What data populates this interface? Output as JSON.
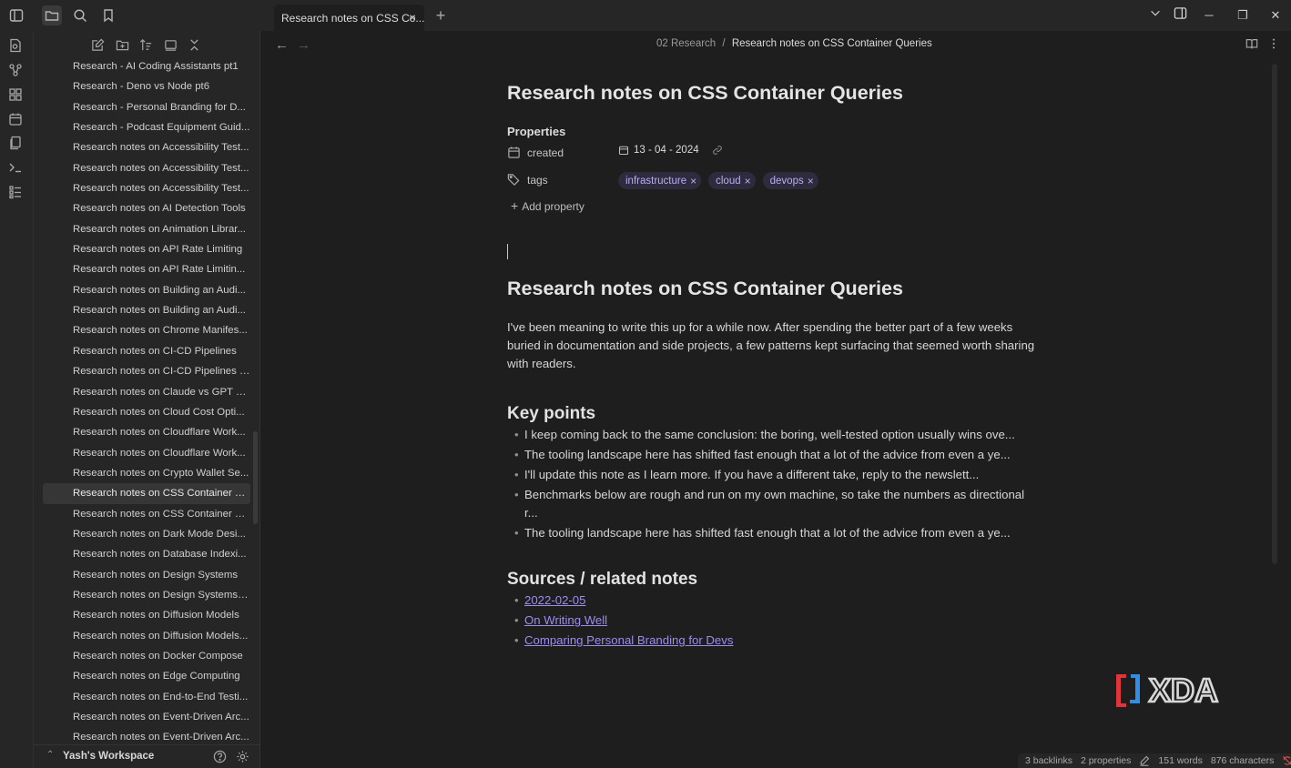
{
  "tab": {
    "title": "Research notes on CSS Co..."
  },
  "breadcrumb": {
    "folder": "02 Research",
    "separator": "/",
    "current": "Research notes on CSS Container Queries"
  },
  "sidebar": {
    "files": [
      "Research - AI Coding Assistants pt1",
      "Research - Deno vs Node pt6",
      "Research - Personal Branding for D...",
      "Research - Podcast Equipment Guid...",
      "Research notes on Accessibility Test...",
      "Research notes on Accessibility Test...",
      "Research notes on Accessibility Test...",
      "Research notes on AI Detection Tools",
      "Research notes on Animation Librar...",
      "Research notes on API Rate Limiting",
      "Research notes on API Rate Limitin...",
      "Research notes on Building an Audi...",
      "Research notes on Building an Audi...",
      "Research notes on Chrome Manifes...",
      "Research notes on CI-CD Pipelines",
      "Research notes on CI-CD Pipelines (...",
      "Research notes on Claude vs GPT C...",
      "Research notes on Cloud Cost Opti...",
      "Research notes on Cloudflare Work...",
      "Research notes on Cloudflare Work...",
      "Research notes on Crypto Wallet Se...",
      "Research notes on CSS Container Q...",
      "Research notes on CSS Container Q...",
      "Research notes on Dark Mode Desi...",
      "Research notes on Database Indexi...",
      "Research notes on Design Systems",
      "Research notes on Design Systems (...",
      "Research notes on Diffusion Models",
      "Research notes on Diffusion Models...",
      "Research notes on Docker Compose",
      "Research notes on Edge Computing",
      "Research notes on End-to-End Testi...",
      "Research notes on Event-Driven Arc...",
      "Research notes on Event-Driven Arc..."
    ],
    "active_index": 21,
    "workspace": "Yash's Workspace"
  },
  "note": {
    "inline_title": "Research notes on CSS Container Queries",
    "properties_heading": "Properties",
    "created_key": "created",
    "created_value": "13 - 04 - 2024",
    "tags_key": "tags",
    "tags": [
      "infrastructure",
      "cloud",
      "devops"
    ],
    "add_property": "Add property",
    "heading": "Research notes on CSS Container Queries",
    "intro": "I've been meaning to write this up for a while now. After spending the better part of a few weeks buried in documentation and side projects, a few patterns kept surfacing that seemed worth sharing with readers.",
    "key_points_heading": "Key points",
    "key_points": [
      "I keep coming back to the same conclusion: the boring, well-tested option usually wins ove...",
      "The tooling landscape here has shifted fast enough that a lot of the advice from even a ye...",
      "I'll update this note as I learn more. If you have a different take, reply to the newslett...",
      "Benchmarks below are rough and run on my own machine, so take the numbers as directional r...",
      "The tooling landscape here has shifted fast enough that a lot of the advice from even a ye..."
    ],
    "sources_heading": "Sources / related notes",
    "sources": [
      "2022-02-05",
      "On Writing Well",
      "Comparing Personal Branding for Devs"
    ]
  },
  "status": {
    "backlinks": "3 backlinks",
    "properties": "2 properties",
    "words": "151 words",
    "characters": "876 characters"
  },
  "colors": {
    "accent": "#9d8cf0",
    "tag_bg": "#2e2b3f",
    "sync_error": "#e0584f",
    "watermark_red": "#e0343d",
    "watermark_blue": "#2f8ee8"
  },
  "watermark": "XDA"
}
